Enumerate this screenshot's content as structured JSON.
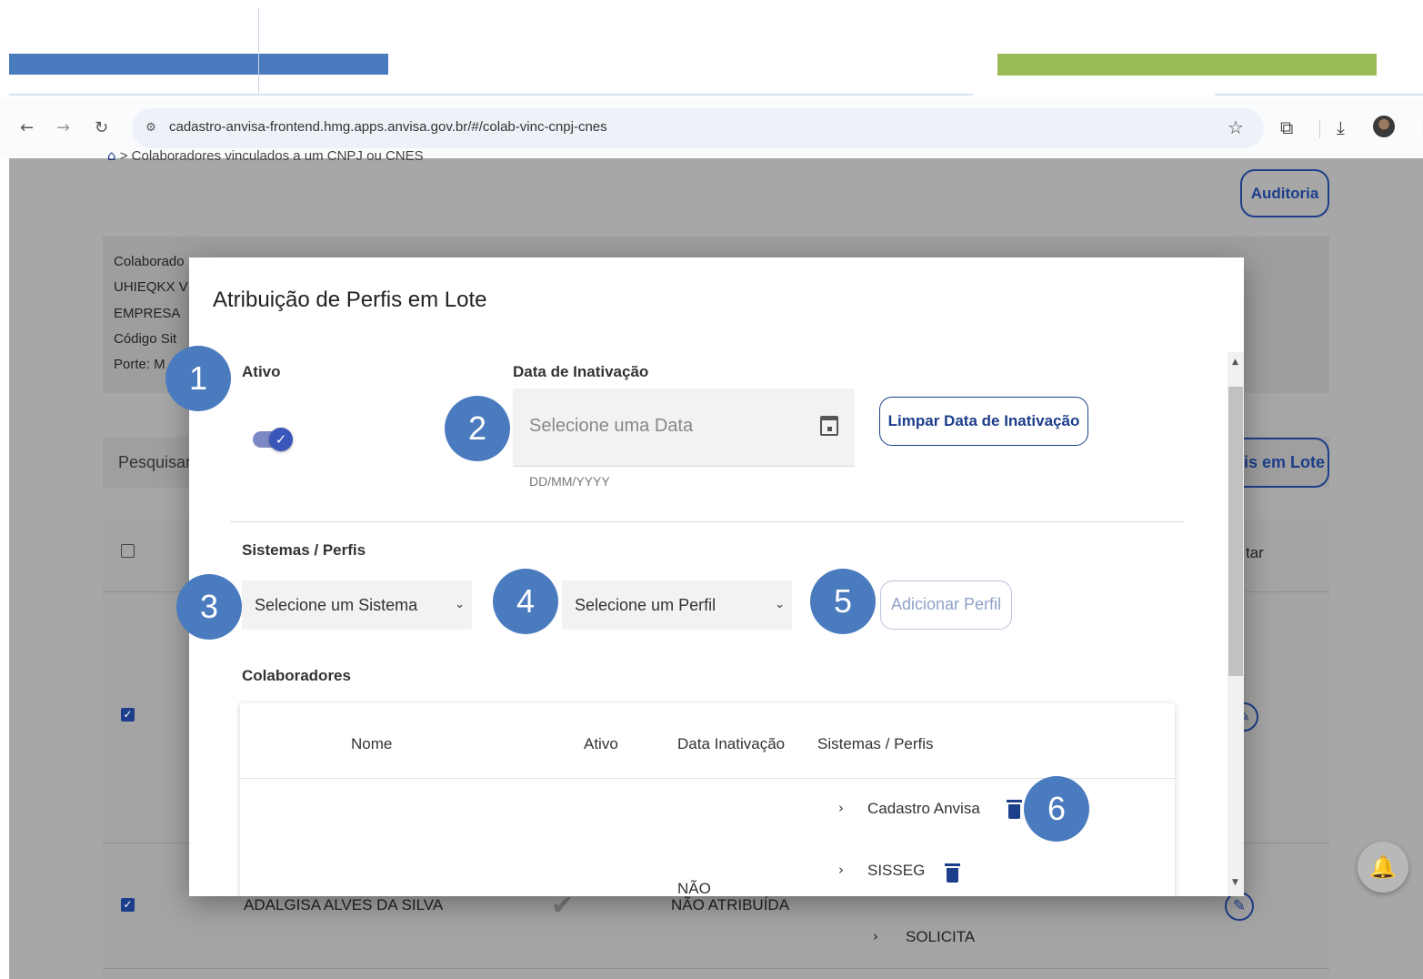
{
  "browser": {
    "url": "cadastro-anvisa-frontend.hmg.apps.anvisa.gov.br/#/colab-vinc-cnpj-cnes"
  },
  "background_page": {
    "breadcrumb": "Colaboradores vinculados a um CNPJ ou CNES",
    "audit_button": "Auditoria",
    "info_lines": [
      "Colaborado",
      "UHIEQKX V",
      "EMPRESA",
      "Código Sit",
      "Porte: M"
    ],
    "search_label": "Pesquisar",
    "batch_button": "is em Lote",
    "table_header_right": "tar",
    "row_name": "ADALGISA ALVES DA SILVA",
    "row_date_status": "NÃO ATRIBUÍDA",
    "row_system": "SOLICITA"
  },
  "modal": {
    "title": "Atribuição de Perfis em Lote",
    "active_label": "Ativo",
    "inactivation_date_label": "Data de Inativação",
    "date_placeholder": "Selecione uma Data",
    "date_hint": "DD/MM/YYYY",
    "clear_date_button": "Limpar Data de Inativação",
    "systems_profiles_label": "Sistemas / Perfis",
    "system_select_placeholder": "Selecione um Sistema",
    "profile_select_placeholder": "Selecione um Perfil",
    "add_profile_button": "Adicionar Perfil",
    "collaborators_label": "Colaboradores",
    "table_headers": {
      "name": "Nome",
      "active": "Ativo",
      "inactivation_date": "Data Inativação",
      "systems_profiles": "Sistemas / Perfis"
    },
    "row": {
      "systems": [
        "Cadastro Anvisa",
        "SISSEG"
      ],
      "date_partial": "NÃO"
    }
  },
  "callouts": [
    "1",
    "2",
    "3",
    "4",
    "5",
    "6"
  ],
  "colors": {
    "primary": "#1d3e8a",
    "callout": "#4a7bbf",
    "doc_green": "#9bbb59",
    "overlay_gray": "#a7a7a7"
  }
}
